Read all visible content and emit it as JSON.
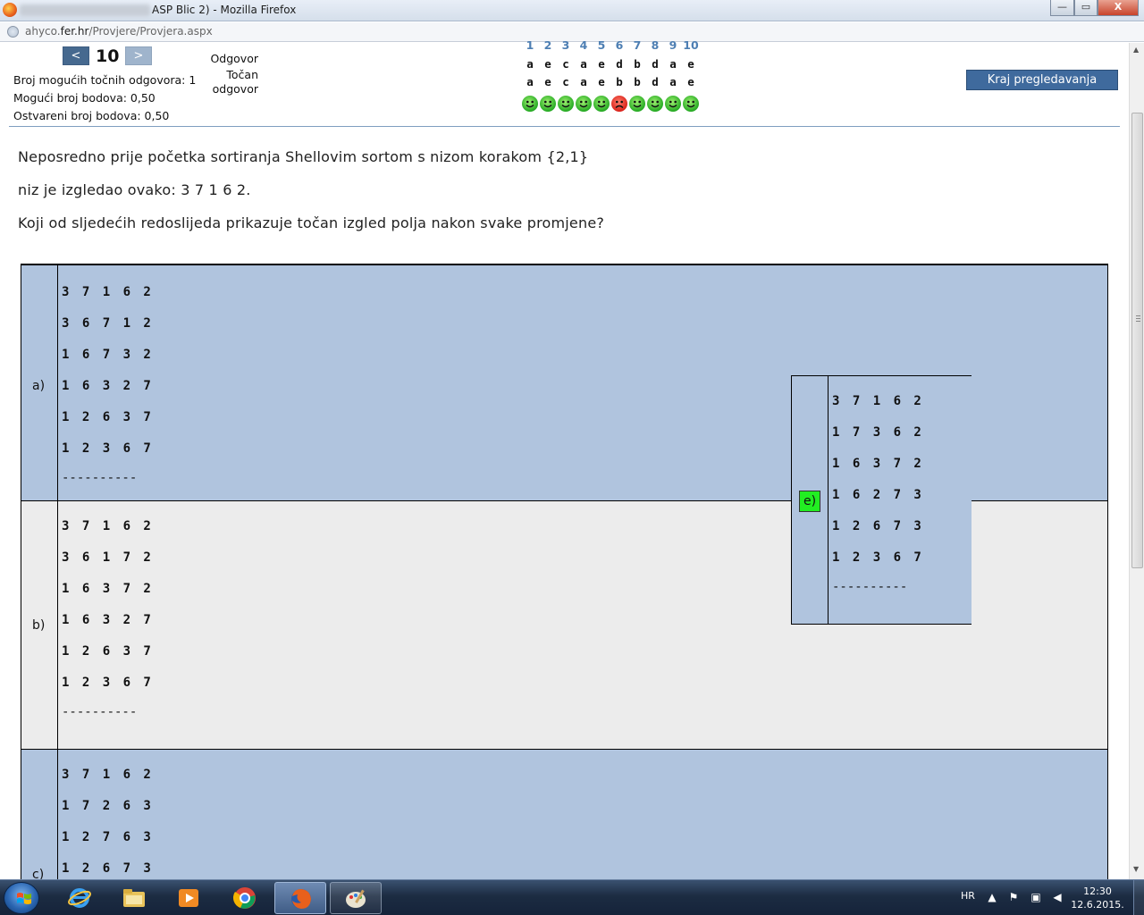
{
  "window": {
    "title_suffix": "ASP Blic 2) - Mozilla Firefox",
    "minimize": "—",
    "maximize": "▭",
    "close": "X"
  },
  "address": {
    "host_prefix": "ahyco.",
    "host_domain": "fer.hr",
    "path": "/Provjere/Provjera.aspx"
  },
  "header": {
    "prev_label": "<",
    "next_label": ">",
    "question_number": "10",
    "max_correct_label": "Broj mogućih točnih odgovora: 1",
    "max_points_label": "Mogući broj bodova: 0,50",
    "earned_points_label": "Ostvareni broj bodova: 0,50",
    "answer_label": "Odgovor",
    "correct_label_1": "Točan",
    "correct_label_2": "odgovor",
    "end_button": "Kraj pregledavanja"
  },
  "answers": {
    "numbers": [
      "1",
      "2",
      "3",
      "4",
      "5",
      "6",
      "7",
      "8",
      "9",
      "10"
    ],
    "given": [
      "a",
      "e",
      "c",
      "a",
      "e",
      "d",
      "b",
      "d",
      "a",
      "e"
    ],
    "correct": [
      "a",
      "e",
      "c",
      "a",
      "e",
      "b",
      "b",
      "d",
      "a",
      "e"
    ],
    "status": [
      "ok",
      "ok",
      "ok",
      "ok",
      "ok",
      "bad",
      "ok",
      "ok",
      "ok",
      "ok"
    ]
  },
  "question": {
    "line1": "Neposredno prije početka sortiranja Shellovim sortom s nizom korakom {2,1}",
    "line2": "niz je izgledao ovako: 3 7 1 6 2.",
    "line3": "Koji od sljedećih redoslijeda prikazuje točan izgled polja nakon svake promjene?"
  },
  "options": {
    "a": {
      "letter": "a)",
      "lines": [
        "3 7 1 6 2",
        "3 6 7 1 2",
        "1 6 7 3 2",
        "1 6 3 2 7",
        "1 2 6 3 7",
        "1 2 3 6 7"
      ],
      "dash": "----------"
    },
    "b": {
      "letter": "b)",
      "lines": [
        "3 7 1 6 2",
        "3 6 1 7 2",
        "1 6 3 7 2",
        "1 6 3 2 7",
        "1 2 6 3 7",
        "1 2 3 6 7"
      ],
      "dash": "----------"
    },
    "c": {
      "letter": "c)",
      "lines": [
        "3 7 1 6 2",
        "1 7 2 6 3",
        "1 2 7 6 3",
        "1 2 6 7 3"
      ]
    },
    "e": {
      "letter": "e)",
      "lines": [
        "3 7 1 6 2",
        "1 7 3 6 2",
        "1 6 3 7 2",
        "1 6 2 7 3",
        "1 2 6 7 3",
        "1 2 3 6 7"
      ],
      "dash": "----------"
    }
  },
  "taskbar": {
    "language": "HR",
    "time": "12:30",
    "date": "12.6.2015."
  },
  "colors": {
    "row_blue": "#b0c4de",
    "row_grey": "#ececec",
    "selected_green": "#22ee22",
    "accent": "#3f6a9d"
  }
}
